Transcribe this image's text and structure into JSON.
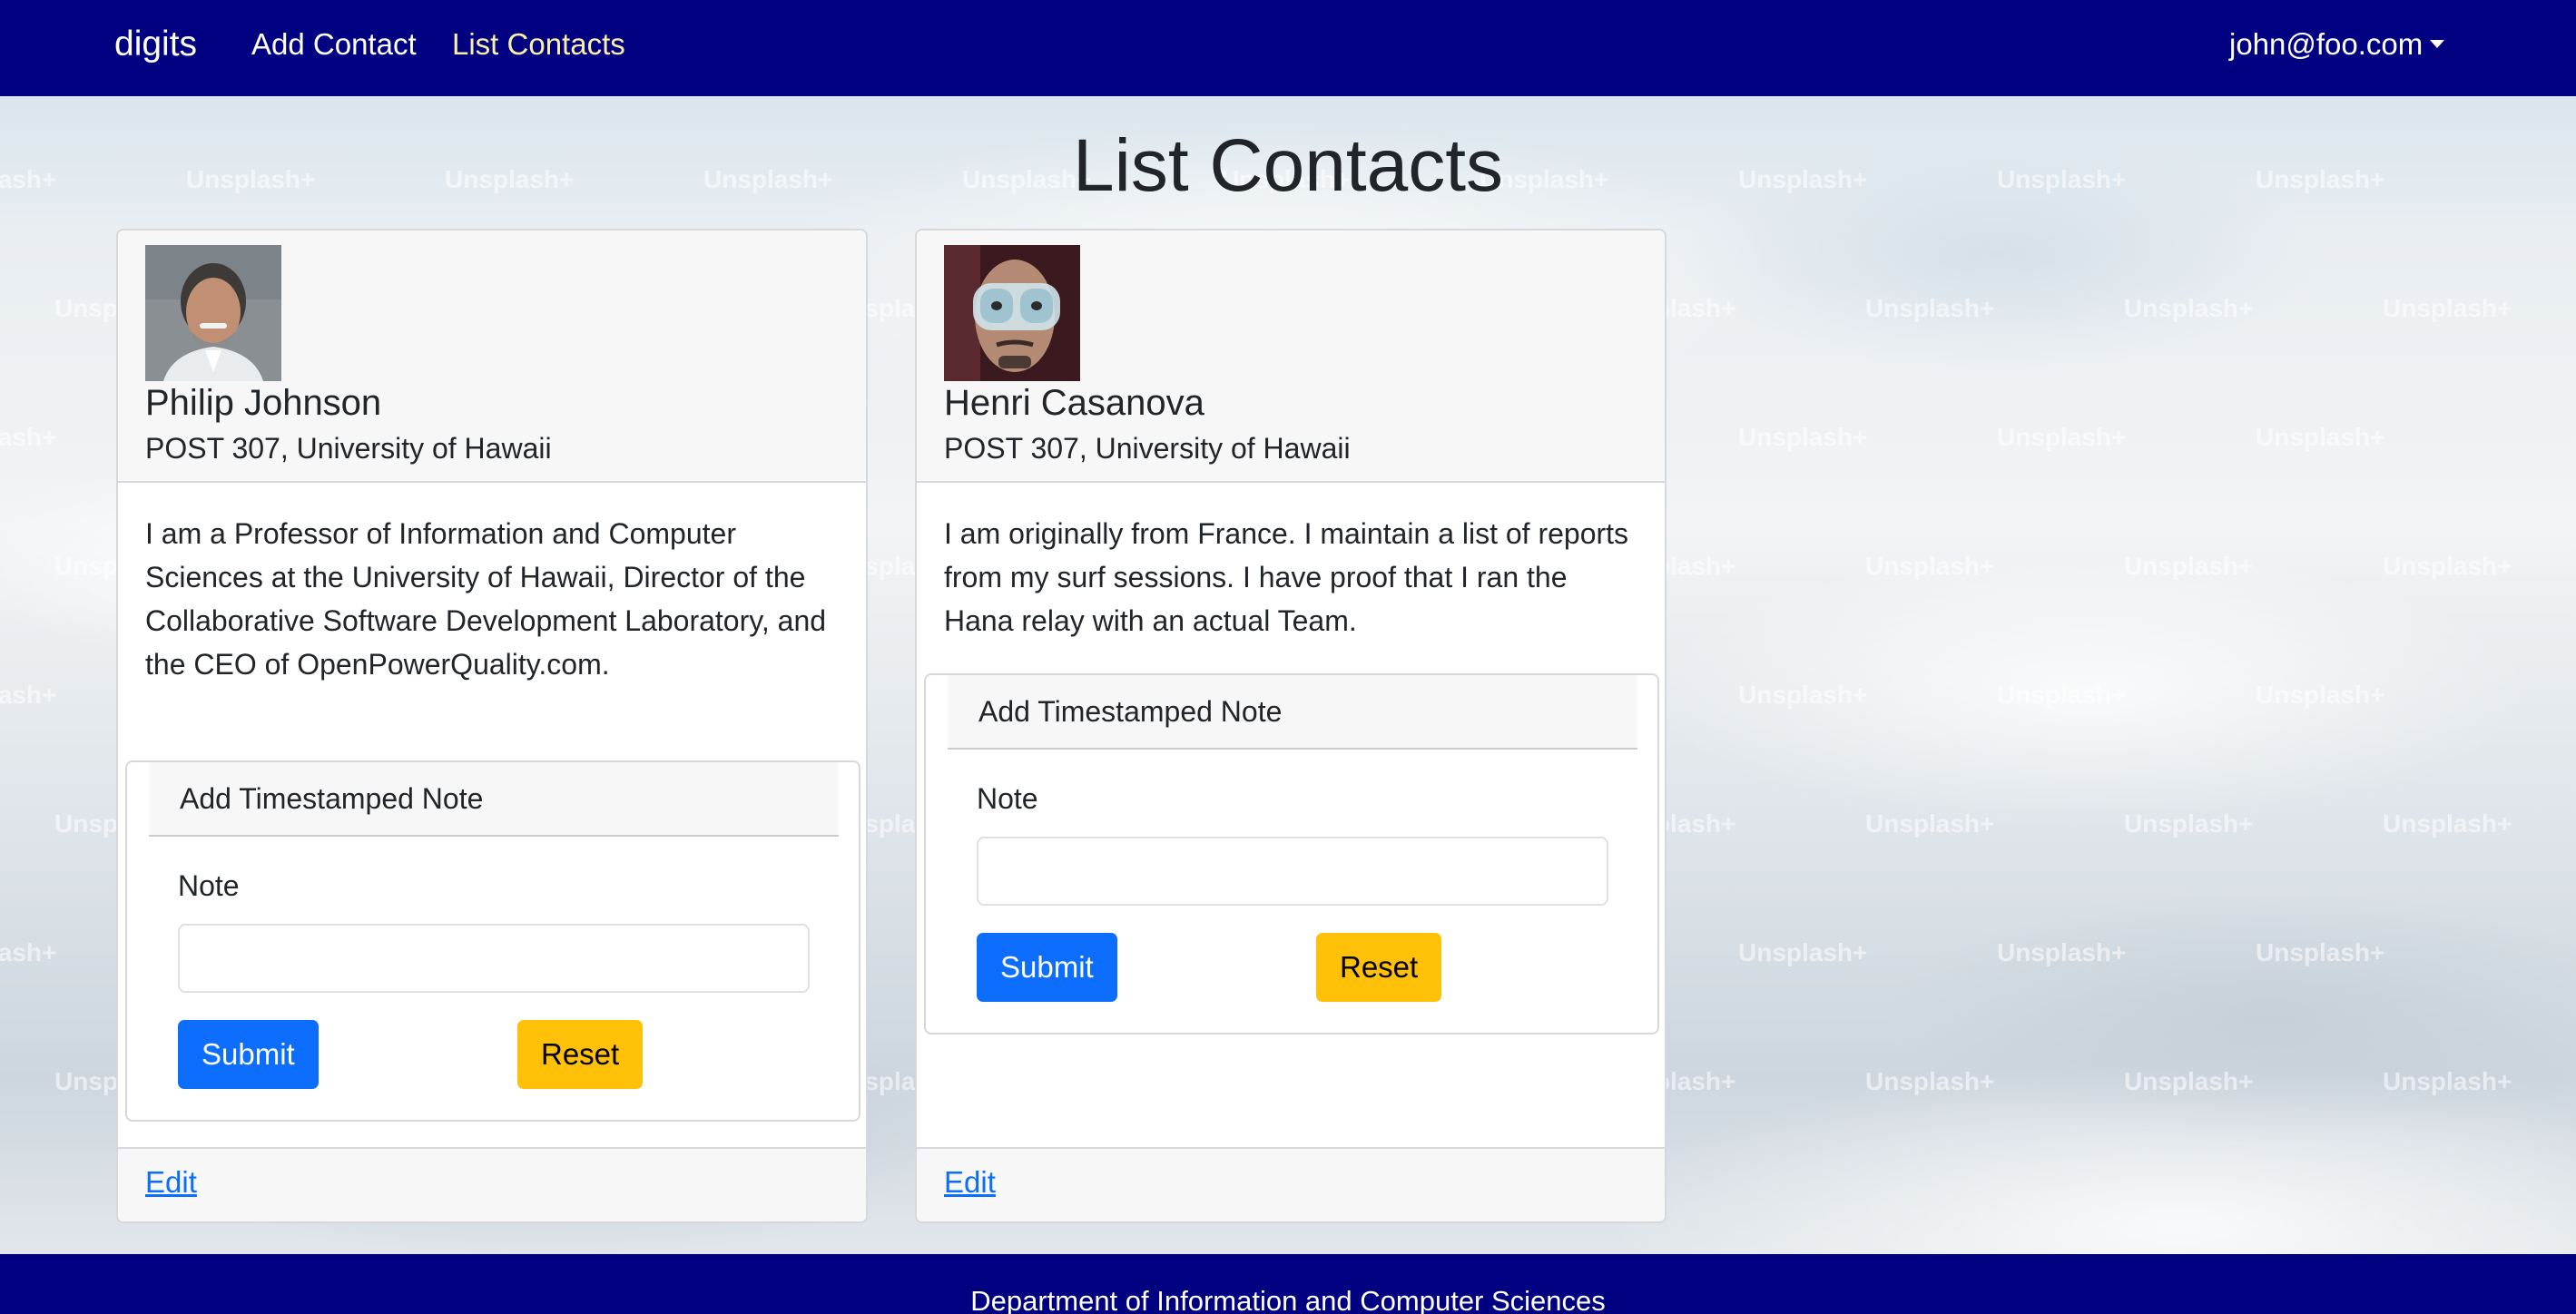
{
  "navbar": {
    "brand": "digits",
    "links": [
      "Add Contact",
      "List Contacts"
    ],
    "active_link": "List Contacts",
    "user_email": "john@foo.com",
    "background_color": "#000080",
    "active_link_color": "#fdf0a6"
  },
  "background_watermark": "Unsplash+",
  "page_title": "List Contacts",
  "contacts": [
    {
      "name": "Philip Johnson",
      "address": "POST 307, University of Hawaii",
      "description": "I am a Professor of Information and Computer Sciences at the University of Hawaii, Director of the Collaborative Software Development Laboratory, and the CEO of OpenPowerQuality.com.",
      "note_form": {
        "title": "Add Timestamped Note",
        "label": "Note",
        "value": "",
        "submit_label": "Submit",
        "reset_label": "Reset"
      },
      "edit_label": "Edit"
    },
    {
      "name": "Henri Casanova",
      "address": "POST 307, University of Hawaii",
      "description": "I am originally from France. I maintain a list of reports from my surf sessions. I have proof that I ran the Hana relay with an actual Team.",
      "note_form": {
        "title": "Add Timestamped Note",
        "label": "Note",
        "value": "",
        "submit_label": "Submit",
        "reset_label": "Reset"
      },
      "edit_label": "Edit"
    }
  ],
  "footer": {
    "text": "Department of Information and Computer Sciences",
    "background_color": "#000080"
  },
  "colors": {
    "submit_button": "#0d6efd",
    "reset_button": "#ffc107",
    "link": "#0d6efd"
  }
}
